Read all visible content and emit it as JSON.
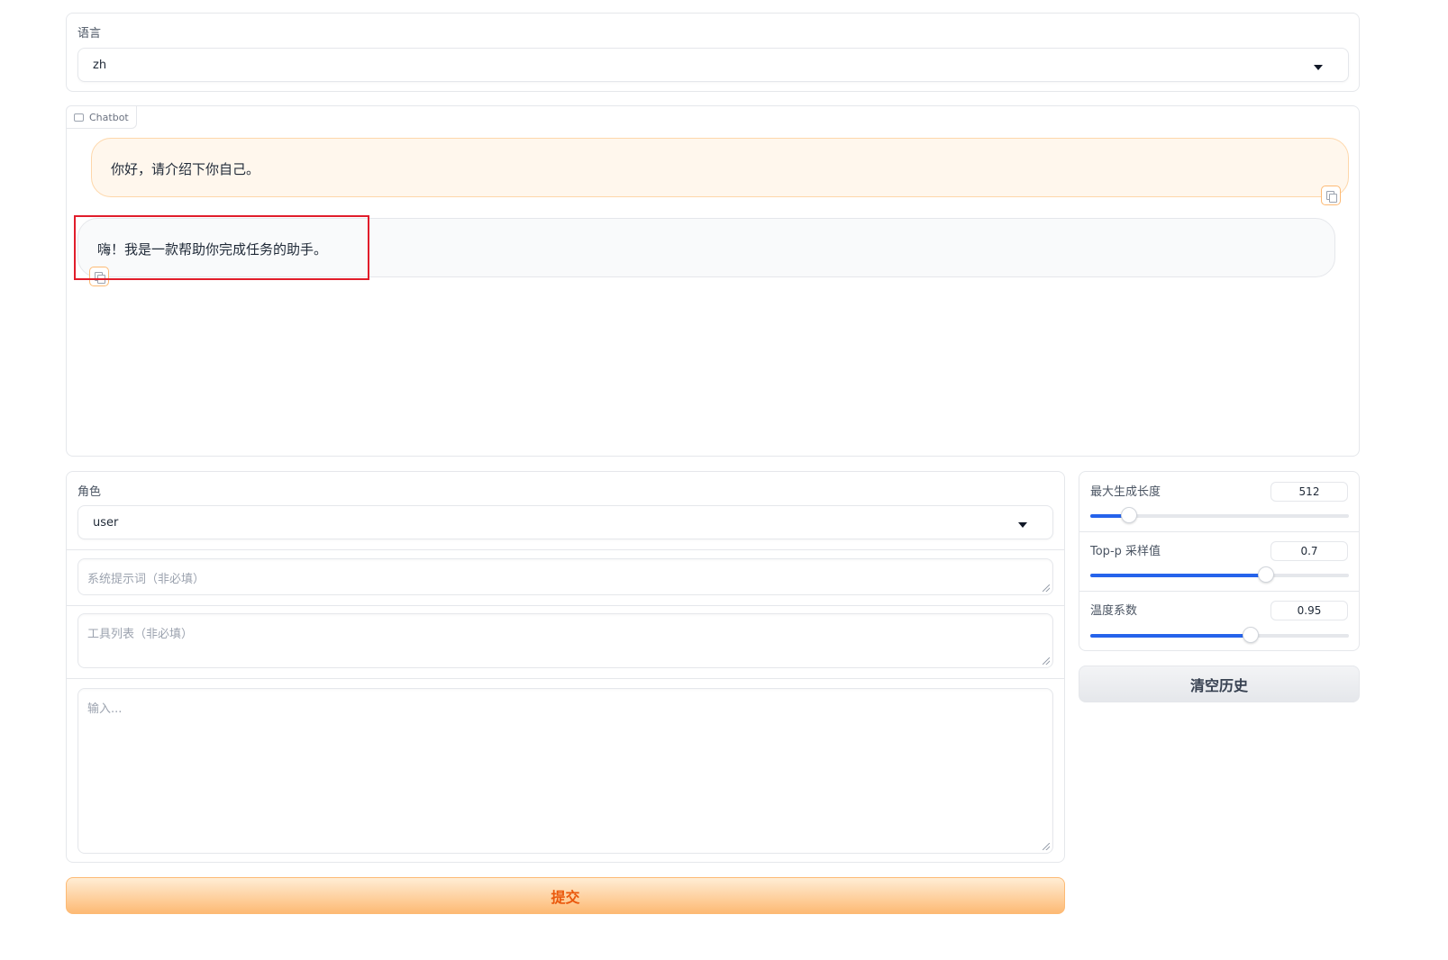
{
  "language": {
    "label": "语言",
    "selected": "zh"
  },
  "chatbot": {
    "tab_label": "Chatbot",
    "messages": [
      {
        "role": "user",
        "text": "你好，请介绍下你自己。"
      },
      {
        "role": "assistant",
        "text": "嗨！我是一款帮助你完成任务的助手。"
      }
    ]
  },
  "role": {
    "label": "角色",
    "selected": "user"
  },
  "system_prompt": {
    "placeholder": "系统提示词（非必填）"
  },
  "tools": {
    "placeholder": "工具列表（非必填）"
  },
  "input": {
    "placeholder": "输入..."
  },
  "submit_label": "提交",
  "clear_label": "清空历史",
  "params": [
    {
      "label": "最大生成长度",
      "value": "512",
      "fraction": 0.15
    },
    {
      "label": "Top-p 采样值",
      "value": "0.7",
      "fraction": 0.68
    },
    {
      "label": "温度系数",
      "value": "0.95",
      "fraction": 0.62
    }
  ],
  "colors": {
    "accent_orange": "#ea580c",
    "slider_blue": "#2563eb",
    "highlight_red": "#e11d2b"
  },
  "icons": [
    "chat-icon",
    "copy-icon",
    "chevron-down-icon"
  ]
}
